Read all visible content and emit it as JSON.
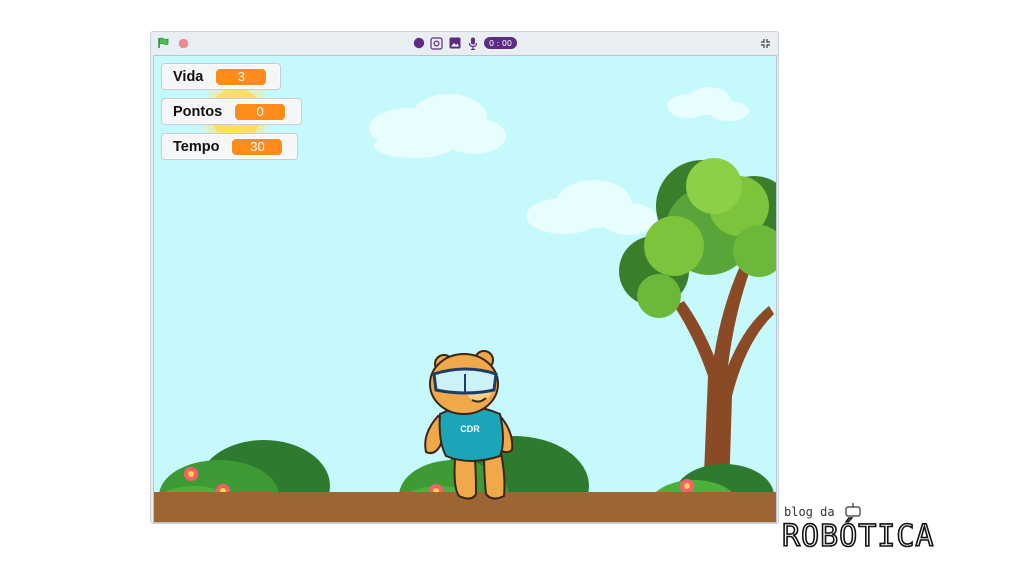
{
  "stage": {
    "sky_color": "#c5f9fb",
    "ground_color": "#9b6632"
  },
  "toolbar": {
    "left_icons": [
      "green-flag-icon",
      "stop-icon"
    ],
    "center_icons": [
      "record-icon",
      "screenshot-icon",
      "image-icon",
      "microphone-icon"
    ],
    "timer_text": "0 : 00",
    "right_icons": [
      "fullscreen-icon"
    ]
  },
  "monitors": [
    {
      "label": "Vida",
      "value": "3"
    },
    {
      "label": "Pontos",
      "value": "0"
    },
    {
      "label": "Tempo",
      "value": "30"
    }
  ],
  "sprite": {
    "shirt_text": "CDR"
  },
  "watermark": {
    "top": "blog da",
    "bottom": "ROBÓTICA"
  }
}
